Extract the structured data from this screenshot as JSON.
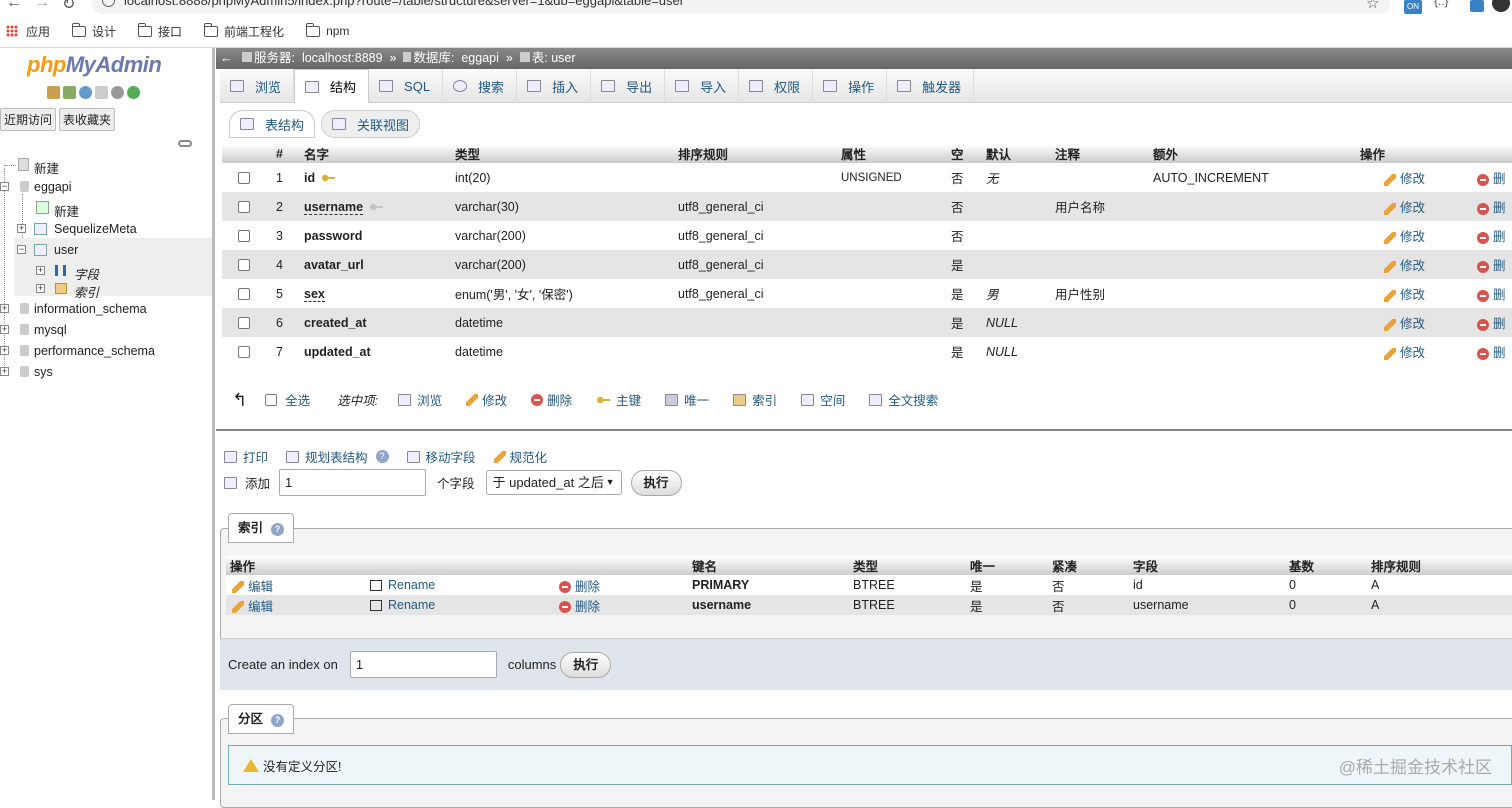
{
  "browser": {
    "url": "localhost:8888/phpMyAdmin5/index.php?route=/table/structure&server=1&db=eggapi&table=user",
    "bookmarks": [
      {
        "label": "应用",
        "icon": "apps-grid-icon"
      },
      {
        "label": "设计",
        "icon": "folder-icon"
      },
      {
        "label": "接口",
        "icon": "folder-icon"
      },
      {
        "label": "前端工程化",
        "icon": "folder-icon"
      },
      {
        "label": "npm",
        "icon": "folder-icon"
      }
    ],
    "ext_badge": "ON"
  },
  "nav": {
    "logo_php": "php",
    "logo_myadmin": "MyAdmin",
    "recent": "近期访问",
    "favorites": "表收藏夹",
    "tree": {
      "new": "新建",
      "db": "eggapi",
      "db_new": "新建",
      "t1": "SequelizeMeta",
      "t2": "user",
      "fields": "字段",
      "indexes": "索引",
      "others": [
        "information_schema",
        "mysql",
        "performance_schema",
        "sys"
      ]
    }
  },
  "breadcrumb": {
    "server_label": "服务器:",
    "server": "localhost:8889",
    "db_label": "数据库:",
    "db": "eggapi",
    "table_label": "表:",
    "table": "user",
    "sep": "»"
  },
  "tabs": [
    "浏览",
    "结构",
    "SQL",
    "搜索",
    "插入",
    "导出",
    "导入",
    "权限",
    "操作",
    "触发器"
  ],
  "subtabs": [
    "表结构",
    "关联视图"
  ],
  "structure": {
    "headers": [
      "#",
      "名字",
      "类型",
      "排序规则",
      "属性",
      "空",
      "默认",
      "注释",
      "额外",
      "操作"
    ],
    "edit": "修改",
    "del": "删",
    "rows": [
      {
        "n": "1",
        "name": "id",
        "type": "int(20)",
        "coll": "",
        "attr": "UNSIGNED",
        "null": "否",
        "def": "无",
        "comment": "",
        "extra": "AUTO_INCREMENT"
      },
      {
        "n": "2",
        "name": "username",
        "type": "varchar(30)",
        "coll": "utf8_general_ci",
        "attr": "",
        "null": "否",
        "def": "",
        "comment": "用户名称",
        "extra": ""
      },
      {
        "n": "3",
        "name": "password",
        "type": "varchar(200)",
        "coll": "utf8_general_ci",
        "attr": "",
        "null": "否",
        "def": "",
        "comment": "",
        "extra": ""
      },
      {
        "n": "4",
        "name": "avatar_url",
        "type": "varchar(200)",
        "coll": "utf8_general_ci",
        "attr": "",
        "null": "是",
        "def": "",
        "comment": "",
        "extra": ""
      },
      {
        "n": "5",
        "name": "sex",
        "type": "enum('男', '女', '保密')",
        "coll": "utf8_general_ci",
        "attr": "",
        "null": "是",
        "def": "男",
        "comment": "用户性别",
        "extra": ""
      },
      {
        "n": "6",
        "name": "created_at",
        "type": "datetime",
        "coll": "",
        "attr": "",
        "null": "是",
        "def": "NULL",
        "comment": "",
        "extra": ""
      },
      {
        "n": "7",
        "name": "updated_at",
        "type": "datetime",
        "coll": "",
        "attr": "",
        "null": "是",
        "def": "NULL",
        "comment": "",
        "extra": ""
      }
    ]
  },
  "bulk": {
    "check_all": "全选",
    "with_selected": "选中项:",
    "actions": [
      "浏览",
      "修改",
      "删除",
      "主键",
      "唯一",
      "索引",
      "空间",
      "全文搜索"
    ]
  },
  "tools": {
    "print": "打印",
    "propose": "规划表结构",
    "move": "移动字段",
    "normalize": "规范化"
  },
  "add": {
    "label": "添加",
    "count": "1",
    "unit": "个字段",
    "position": "于 updated_at 之后",
    "go": "执行"
  },
  "indexes": {
    "legend": "索引",
    "headers": [
      "操作",
      "",
      "",
      "键名",
      "类型",
      "唯一",
      "紧凑",
      "字段",
      "基数",
      "排序规则"
    ],
    "edit": "编辑",
    "rename": "Rename",
    "del": "删除",
    "rows": [
      {
        "key": "PRIMARY",
        "type": "BTREE",
        "unique": "是",
        "packed": "否",
        "field": "id",
        "card": "0",
        "coll": "A"
      },
      {
        "key": "username",
        "type": "BTREE",
        "unique": "是",
        "packed": "否",
        "field": "username",
        "card": "0",
        "coll": "A"
      }
    ],
    "create_label": "Create an index on",
    "create_count": "1",
    "columns": "columns",
    "go": "执行"
  },
  "partition": {
    "legend": "分区",
    "none": "没有定义分区!"
  },
  "watermark": "@稀土掘金技术社区"
}
